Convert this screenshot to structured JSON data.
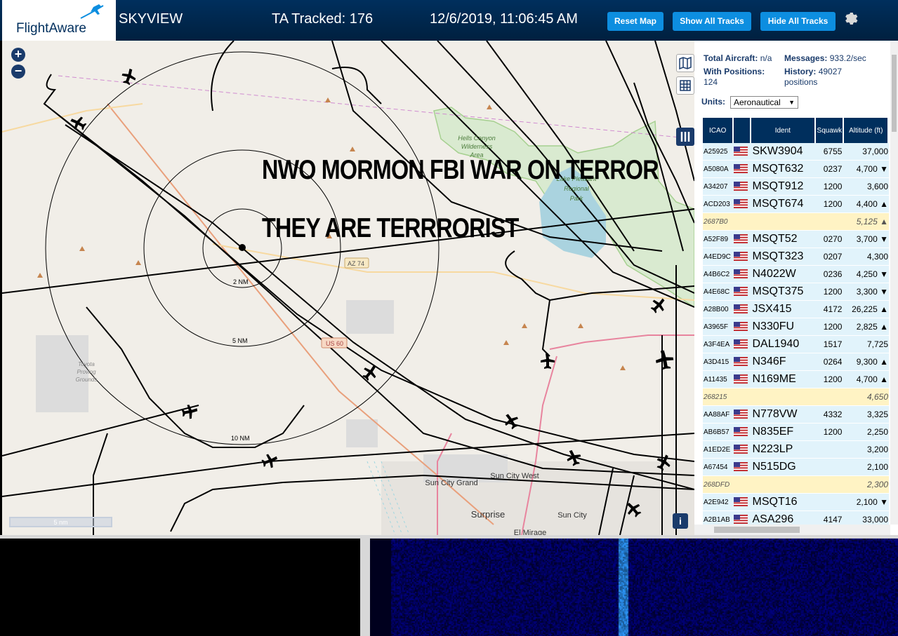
{
  "header": {
    "logo_text": "FlightAware",
    "site_name": "SKYVIEW",
    "tracked": "TA Tracked: 176",
    "datetime": "12/6/2019, 11:06:45 AM",
    "buttons": {
      "reset": "Reset Map",
      "show_all": "Show All Tracks",
      "hide_all": "Hide All Tracks"
    }
  },
  "map": {
    "overlay_line1": "NWO MORMON FBI WAR ON TERROR",
    "overlay_line2": "THEY ARE TERRRORIST",
    "ring_labels": [
      "2 NM",
      "5 NM",
      "10 NM"
    ],
    "place_labels": [
      "Hells Canyon Wilderness Area",
      "Lake Pleasant Regional Park",
      "Sun City Grand",
      "Sun City West",
      "Surprise",
      "Sun City",
      "El Mirage",
      "Toyota Proving Grounds"
    ],
    "road_labels": [
      "AZ 74",
      "US 60"
    ],
    "scale": "5 nm",
    "zoom_in": "+",
    "zoom_out": "−",
    "info": "i"
  },
  "stats": {
    "total_label": "Total Aircraft:",
    "total_value": "n/a",
    "messages_label": "Messages:",
    "messages_value": "933.2/sec",
    "positions_label": "With Positions:",
    "positions_value": "124",
    "history_label": "History:",
    "history_value": "49027",
    "history_unit": "positions",
    "units_label": "Units:",
    "units_value": "Aeronautical"
  },
  "table": {
    "headers": {
      "icao": "ICAO",
      "ident": "Ident",
      "squawk": "Squawk",
      "altitude": "Altitude (ft)"
    },
    "rows": [
      {
        "icao": "A25925",
        "ident": "SKW3904",
        "squawk": "6755",
        "alt": "37,000",
        "sel": false,
        "flag": true
      },
      {
        "icao": "A5080A",
        "ident": "MSQT632",
        "squawk": "0237",
        "alt": "4,700 ▼",
        "sel": false,
        "flag": true
      },
      {
        "icao": "A34207",
        "ident": "MSQT912",
        "squawk": "1200",
        "alt": "3,600",
        "sel": false,
        "flag": true
      },
      {
        "icao": "ACD203",
        "ident": "MSQT674",
        "squawk": "1200",
        "alt": "4,400 ▲",
        "sel": false,
        "flag": true
      },
      {
        "icao": "2687B0",
        "ident": "",
        "squawk": "",
        "alt": "5,125 ▲",
        "sel": true,
        "flag": false
      },
      {
        "icao": "A52F89",
        "ident": "MSQT52",
        "squawk": "0270",
        "alt": "3,700 ▼",
        "sel": false,
        "flag": true
      },
      {
        "icao": "A4ED9C",
        "ident": "MSQT323",
        "squawk": "0207",
        "alt": "4,300",
        "sel": false,
        "flag": true
      },
      {
        "icao": "A4B6C2",
        "ident": "N4022W",
        "squawk": "0236",
        "alt": "4,250 ▼",
        "sel": false,
        "flag": true
      },
      {
        "icao": "A4E68C",
        "ident": "MSQT375",
        "squawk": "1200",
        "alt": "3,300 ▼",
        "sel": false,
        "flag": true
      },
      {
        "icao": "A28B00",
        "ident": "JSX415",
        "squawk": "4172",
        "alt": "26,225 ▲",
        "sel": false,
        "flag": true
      },
      {
        "icao": "A3965F",
        "ident": "N330FU",
        "squawk": "1200",
        "alt": "2,825 ▲",
        "sel": false,
        "flag": true
      },
      {
        "icao": "A3F4EA",
        "ident": "DAL1940",
        "squawk": "1517",
        "alt": "7,725",
        "sel": false,
        "flag": true
      },
      {
        "icao": "A3D415",
        "ident": "N346F",
        "squawk": "0264",
        "alt": "9,300 ▲",
        "sel": false,
        "flag": true
      },
      {
        "icao": "A11435",
        "ident": "N169ME",
        "squawk": "1200",
        "alt": "4,700 ▲",
        "sel": false,
        "flag": true
      },
      {
        "icao": "268215",
        "ident": "",
        "squawk": "",
        "alt": "4,650",
        "sel": true,
        "flag": false
      },
      {
        "icao": "AA88AF",
        "ident": "N778VW",
        "squawk": "4332",
        "alt": "3,325",
        "sel": false,
        "flag": true
      },
      {
        "icao": "AB6B57",
        "ident": "N835EF",
        "squawk": "1200",
        "alt": "2,250",
        "sel": false,
        "flag": true
      },
      {
        "icao": "A1ED2E",
        "ident": "N223LP",
        "squawk": "",
        "alt": "3,200",
        "sel": false,
        "flag": true
      },
      {
        "icao": "A67454",
        "ident": "N515DG",
        "squawk": "",
        "alt": "2,100",
        "sel": false,
        "flag": true
      },
      {
        "icao": "268DFD",
        "ident": "",
        "squawk": "",
        "alt": "2,300",
        "sel": true,
        "flag": false
      },
      {
        "icao": "A2E942",
        "ident": "MSQT16",
        "squawk": "",
        "alt": "2,100 ▼",
        "sel": false,
        "flag": true
      },
      {
        "icao": "A2B1AB",
        "ident": "ASA296",
        "squawk": "4147",
        "alt": "33,000",
        "sel": false,
        "flag": true
      }
    ]
  }
}
